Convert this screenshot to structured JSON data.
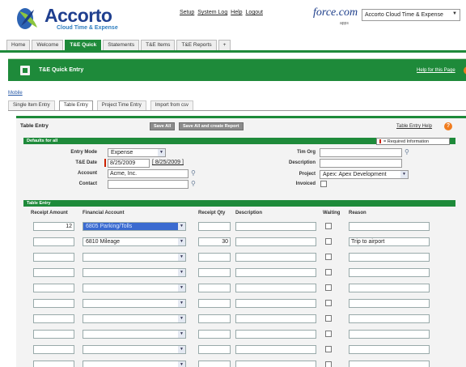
{
  "brand": {
    "name": "Accorto",
    "tagline": "Cloud Time & Expense"
  },
  "top_links": [
    "Setup",
    "System Log",
    "Help",
    "Logout"
  ],
  "platform": {
    "logo": "force.com",
    "sub": "apps"
  },
  "app_selector": {
    "value": "Accorto Cloud Time & Expense"
  },
  "app_tabs": [
    "Home",
    "Welcome",
    "T&E Quick",
    "Statements",
    "T&E Items",
    "T&E Reports",
    "+"
  ],
  "page": {
    "title": "T&E Quick Entry",
    "help": "Help for this Page"
  },
  "mobile_link": "Mobile",
  "sub_tabs": [
    "Single Item Entry",
    "Table Entry",
    "Project Time Entry",
    "Import from csv"
  ],
  "panel": {
    "title": "Table Entry",
    "save_all": "Save All",
    "save_create": "Save All and create Report",
    "help": "Table Entry Help"
  },
  "defaults": {
    "section_title": "Defaults for all",
    "required_info": "= Required Information",
    "labels": {
      "entry_mode": "Entry Mode",
      "te_date": "T&E Date",
      "account": "Account",
      "contact": "Contact",
      "tim_org": "Tim Org",
      "description": "Description",
      "project": "Project",
      "invoiced": "Invoiced"
    },
    "values": {
      "entry_mode": "Expense",
      "te_date": "8/25/2009",
      "te_date_link": "[ 8/25/2009 ]",
      "account": "Acme, Inc.",
      "contact": "",
      "tim_org": "",
      "description": "",
      "project": "Apex: Apex Development"
    }
  },
  "entry_table": {
    "section_title": "Table Entry",
    "columns": [
      "Receipt Amount",
      "Financial Account",
      "Receipt Qty",
      "Description",
      "Waiting",
      "Reason"
    ],
    "rows": [
      {
        "amount": "12",
        "account": "6805 Parking/Tolls",
        "qty": "",
        "description": "",
        "reason": ""
      },
      {
        "amount": "",
        "account": "6810 Mileage",
        "qty": "30",
        "description": "",
        "reason": "Trip to airport"
      },
      {
        "amount": "",
        "account": "",
        "qty": "",
        "description": "",
        "reason": ""
      },
      {
        "amount": "",
        "account": "",
        "qty": "",
        "description": "",
        "reason": ""
      },
      {
        "amount": "",
        "account": "",
        "qty": "",
        "description": "",
        "reason": ""
      },
      {
        "amount": "",
        "account": "",
        "qty": "",
        "description": "",
        "reason": ""
      },
      {
        "amount": "",
        "account": "",
        "qty": "",
        "description": "",
        "reason": ""
      },
      {
        "amount": "",
        "account": "",
        "qty": "",
        "description": "",
        "reason": ""
      },
      {
        "amount": "",
        "account": "",
        "qty": "",
        "description": "",
        "reason": ""
      },
      {
        "amount": "",
        "account": "",
        "qty": "",
        "description": "",
        "reason": ""
      }
    ]
  },
  "colors": {
    "brand_green": "#1e8a3a",
    "brand_blue": "#1f3f8f",
    "accent_orange": "#f07c1e",
    "highlight_blue": "#3a6ad0"
  }
}
